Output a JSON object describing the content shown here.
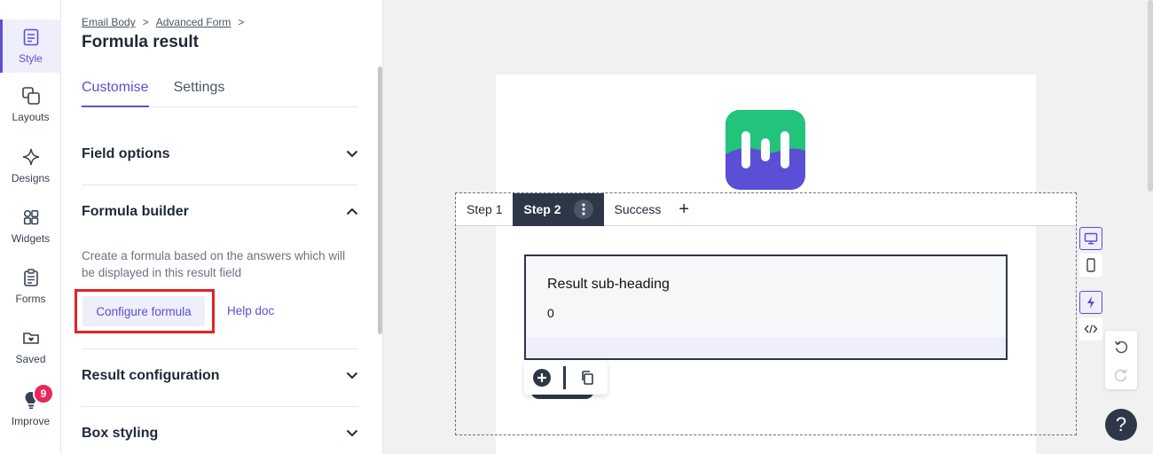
{
  "rail": {
    "items": [
      {
        "label": "Style"
      },
      {
        "label": "Layouts"
      },
      {
        "label": "Designs"
      },
      {
        "label": "Widgets"
      },
      {
        "label": "Forms"
      },
      {
        "label": "Saved"
      },
      {
        "label": "Improve",
        "badge": "9"
      }
    ]
  },
  "panel": {
    "breadcrumb": {
      "first": "Email Body",
      "second": "Advanced Form",
      "sep": ">"
    },
    "title": "Formula result",
    "tabs": [
      "Customise",
      "Settings"
    ],
    "sections": {
      "field_options": "Field options",
      "formula_builder": "Formula builder",
      "result_configuration": "Result configuration",
      "box_styling": "Box styling"
    },
    "formula_description": "Create a formula based on the answers which will be displayed in this result field",
    "configure_label": "Configure formula",
    "help_label": "Help doc"
  },
  "canvas": {
    "steps": [
      "Step 1",
      "Step 2",
      "Success"
    ],
    "add_step": "+",
    "result_heading": "Result sub-heading",
    "result_value": "0"
  },
  "help_fab": "?",
  "colors": {
    "accent": "#5b4fd6",
    "dark": "#2d3748",
    "highlight": "#e32222",
    "badge": "#e8275b"
  }
}
